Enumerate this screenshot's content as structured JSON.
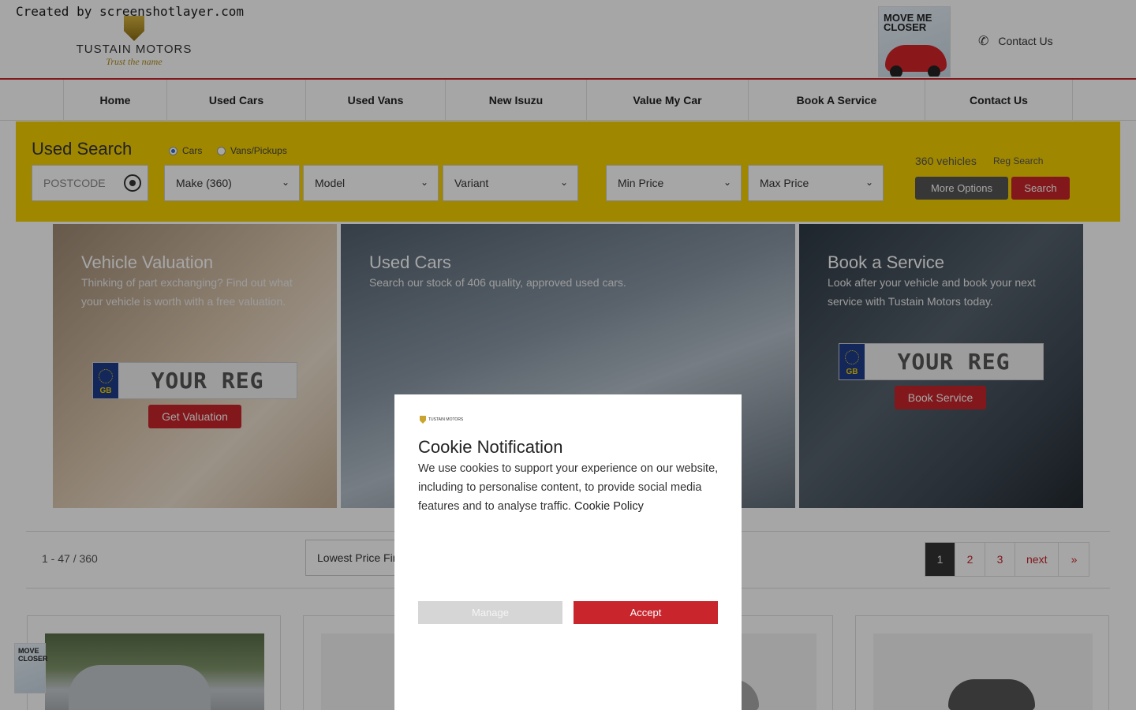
{
  "watermark": "Created by screenshotlayer.com",
  "header": {
    "logo_brand": "TUSTAIN MOTORS",
    "logo_tagline": "Trust the name",
    "move_closer": "MOVE ME CLOSER",
    "contact": "Contact Us"
  },
  "nav": {
    "items": [
      {
        "label": "Home"
      },
      {
        "label": "Used Cars"
      },
      {
        "label": "Used Vans"
      },
      {
        "label": "New Isuzu"
      },
      {
        "label": "Value My Car"
      },
      {
        "label": "Book A Service"
      },
      {
        "label": "Contact Us"
      }
    ]
  },
  "search": {
    "title": "Used Search",
    "radio_cars": "Cars",
    "radio_vans": "Vans/Pickups",
    "postcode_placeholder": "POSTCODE",
    "make": "Make (360)",
    "model": "Model",
    "variant": "Variant",
    "min_price": "Min Price",
    "max_price": "Max Price",
    "vehicle_count": "360 vehicles",
    "reg_search": "Reg Search",
    "more_options": "More Options",
    "search_button": "Search"
  },
  "panels": {
    "valuation": {
      "title": "Vehicle Valuation",
      "text": "Thinking of part exchanging? Find out what your vehicle is worth with a free valuation.",
      "reg_country": "GB",
      "reg_value": "YOUR REG",
      "button": "Get Valuation"
    },
    "used": {
      "title": "Used Cars",
      "text": "Search our stock of 406 quality, approved used cars."
    },
    "service": {
      "title": "Book a Service",
      "text": "Look after your vehicle and book your next service with Tustain Motors today.",
      "reg_country": "GB",
      "reg_value": "YOUR REG",
      "button": "Book Service"
    }
  },
  "results": {
    "count": "1 - 47 / 360",
    "sort": "Lowest Price First",
    "pages": [
      "1",
      "2",
      "3",
      "next",
      "»"
    ]
  },
  "mini_move": "MOVE CLOSER",
  "cookie": {
    "logo": "TUSTAIN MOTORS",
    "title": "Cookie Notification",
    "body": "We use cookies to support your experience on our website, including to personalise content, to provide social media features and to analyse traffic.",
    "policy_link": "Cookie Policy",
    "manage": "Manage",
    "accept": "Accept"
  }
}
